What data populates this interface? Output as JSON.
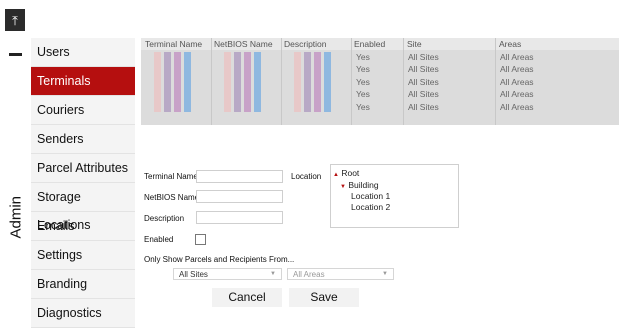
{
  "nav": {
    "section_label": "Admin",
    "items": [
      {
        "label": "Users"
      },
      {
        "label": "Terminals"
      },
      {
        "label": "Couriers"
      },
      {
        "label": "Senders"
      },
      {
        "label": "Parcel Attributes"
      },
      {
        "label": "Storage Locations"
      },
      {
        "label": "Emails"
      },
      {
        "label": "Settings"
      },
      {
        "label": "Branding"
      },
      {
        "label": "Diagnostics"
      }
    ]
  },
  "table": {
    "headers": [
      "Terminal Name",
      "NetBIOS Name",
      "Description",
      "Enabled",
      "Site",
      "Areas"
    ],
    "rows": [
      {
        "enabled": "Yes",
        "site": "All Sites",
        "areas": "All Areas"
      },
      {
        "enabled": "Yes",
        "site": "All Sites",
        "areas": "All Areas"
      },
      {
        "enabled": "Yes",
        "site": "All Sites",
        "areas": "All Areas"
      },
      {
        "enabled": "Yes",
        "site": "All Sites",
        "areas": "All Areas"
      },
      {
        "enabled": "Yes",
        "site": "All Sites",
        "areas": "All Areas"
      }
    ],
    "redacted_colors": [
      "#e8c8c8",
      "#b8a9c6",
      "#c8a2c8",
      "#8fb8e0"
    ]
  },
  "form": {
    "terminal_name_label": "Terminal Name",
    "netbios_label": "NetBIOS Name",
    "description_label": "Description",
    "enabled_label": "Enabled",
    "location_label": "Location",
    "location_tree": {
      "root": "Root",
      "building": "Building",
      "locations": [
        "Location 1",
        "Location 2"
      ]
    },
    "filter_label": "Only Show Parcels and Recipients From...",
    "sites_select": "All Sites",
    "areas_select": "All Areas",
    "cancel_label": "Cancel",
    "save_label": "Save"
  },
  "colors": {
    "accent": "#b50f0f"
  },
  "icons": {
    "top_button": "collapse-up-icon"
  }
}
